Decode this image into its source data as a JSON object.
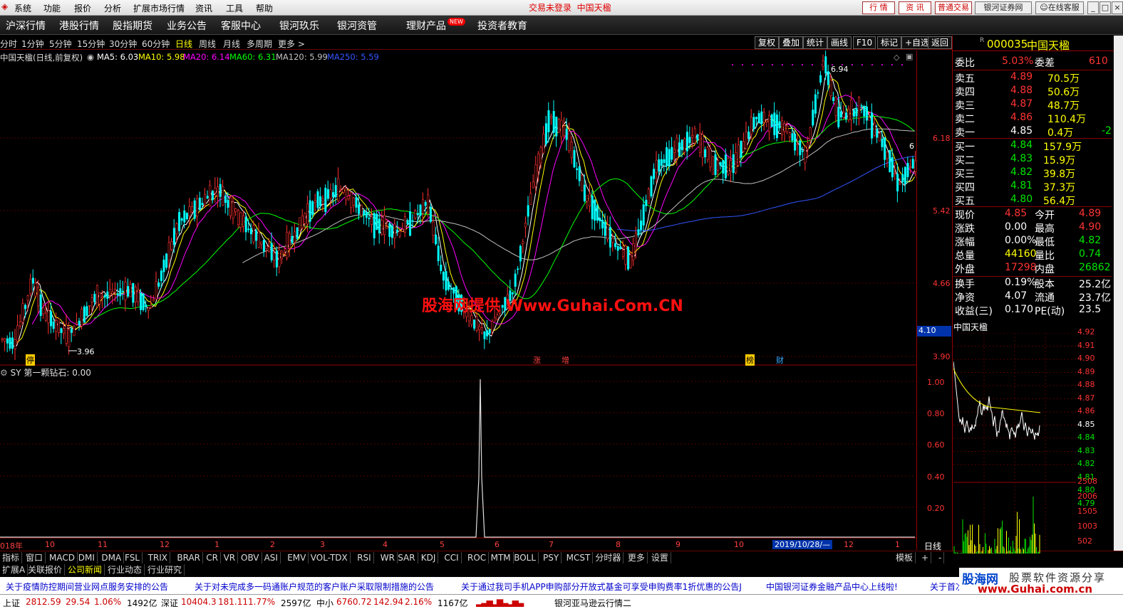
{
  "menu": {
    "items": [
      "系统",
      "功能",
      "报价",
      "分析",
      "扩展市场行情",
      "资讯",
      "工具",
      "帮助"
    ],
    "status_text": "交易未登录",
    "stock_title": "中国天楹",
    "buttons": [
      "行 情",
      "资 讯",
      "普通交易",
      "银河证券网",
      "在线客服"
    ]
  },
  "nav": {
    "items": [
      "沪深行情",
      "港股行情",
      "股指期货",
      "业务公告",
      "客服中心",
      "银河玖乐",
      "银河资管",
      "理财产品",
      "投资者教育"
    ],
    "badge": "NEW"
  },
  "periods": {
    "items": [
      "分时",
      "1分钟",
      "5分钟",
      "15分钟",
      "30分钟",
      "60分钟",
      "日线",
      "周线",
      "月线",
      "多周期",
      "更多 >"
    ],
    "active": "日线"
  },
  "tools": [
    "复权",
    "叠加",
    "统计",
    "画线",
    "F10",
    "标记",
    "+自选",
    "返回"
  ],
  "legend": {
    "name": "中国天楹(日线,前复权)",
    "ma5": "MA5: 6.03",
    "ma10": "MA10: 5.98",
    "ma20": "MA20: 6.14",
    "ma60": "MA60: 6.31",
    "ma120": "MA120: 5.99",
    "ma250": "MA250: 5.59"
  },
  "colors": {
    "ma5": "#ffffff",
    "ma10": "#ffff00",
    "ma20": "#ff00ff",
    "ma60": "#00ff00",
    "ma120": "#c0c0c0",
    "ma250": "#3355ff",
    "up": "#ff3030",
    "down": "#00ffff"
  },
  "main_axis": {
    "labels": [
      "6.18",
      "5.42",
      "4.66",
      "3.90"
    ],
    "current": "4.10"
  },
  "annotations": {
    "high": "6.94",
    "low": "3.96",
    "right": "6",
    "markers": [
      "停",
      "涨",
      "增",
      "榜",
      "财"
    ]
  },
  "watermark": "股海网提供 Www.Guhai.Com.CN",
  "indicator": {
    "title": "SY 第一颗钻石: 0.00",
    "axis": [
      "1.00",
      "0.80",
      "0.60",
      "0.40",
      "0.20"
    ]
  },
  "time_axis": {
    "labels": [
      "018年",
      "10",
      "11",
      "12",
      "1",
      "2",
      "3",
      "4",
      "5",
      "6",
      "7",
      "8",
      "9",
      "10",
      "12",
      "1"
    ],
    "cursor": "2019/10/28/—",
    "mode": "日线"
  },
  "indicator_tabs": [
    "指标",
    "窗口",
    "MACD",
    "DMI",
    "DMA",
    "FSL",
    "TRIX",
    "BRAR",
    "CR",
    "VR",
    "OBV",
    "ASI",
    "EMV",
    "VOL-TDX",
    "RSI",
    "WR",
    "SAR",
    "KDJ",
    "CCI",
    "ROC",
    "MTM",
    "BOLL",
    "PSY",
    "MCST",
    "分时器",
    "更多",
    "设置"
  ],
  "template_btn": "模板",
  "tabs2": [
    "扩展A",
    "关联报价",
    "公司新闻",
    "行业动态",
    "行业研究"
  ],
  "news": [
    "关于疫情防控期间营业网点服务安排的公告",
    "关于对未完成多一码通账户规范的客户账户采取限制措施的公告",
    "关于通过我司手机APP申购部分开放式基金可享受申购费率1折优惠的公告J",
    "中国银河证券金融产品中心上线啦!",
    "关于首次"
  ],
  "status": {
    "sh": "上证",
    "sh_val": "2812.59",
    "sh_chg": "29.54",
    "sh_pct": "1.06%",
    "sh_amt": "1492亿",
    "sz": "深证",
    "sz_val": "10404.3",
    "sz_chg": "181.11",
    "sz_pct": "1.77%",
    "sz_amt": "2597亿",
    "zx": "中小",
    "zx_val": "6760.72",
    "zx_chg": "142.94",
    "zx_pct": "2.16%",
    "zx_amt": "1167亿",
    "broker": "银河亚马逊云行情二"
  },
  "quote": {
    "code": "000035",
    "name": "中国天楹",
    "prefix": "R",
    "wb_label": "委比",
    "wb": "5.03%",
    "wc_label": "委差",
    "wc": "610",
    "sells": [
      [
        "卖五",
        "4.89",
        "70.5万"
      ],
      [
        "卖四",
        "4.88",
        "50.6万"
      ],
      [
        "卖三",
        "4.87",
        "48.7万"
      ],
      [
        "卖二",
        "4.86",
        "110.4万"
      ],
      [
        "卖一",
        "4.85",
        "0.4万"
      ]
    ],
    "sell1_extra": "-2",
    "buys": [
      [
        "买一",
        "4.84",
        "157.9万"
      ],
      [
        "买二",
        "4.83",
        "15.9万"
      ],
      [
        "买三",
        "4.82",
        "39.8万"
      ],
      [
        "买四",
        "4.81",
        "37.3万"
      ],
      [
        "买五",
        "4.80",
        "56.4万"
      ]
    ],
    "stats": [
      [
        "现价",
        "4.85",
        "今开",
        "4.89"
      ],
      [
        "涨跌",
        "0.00",
        "最高",
        "4.90"
      ],
      [
        "涨幅",
        "0.00%",
        "最低",
        "4.82"
      ],
      [
        "总量",
        "44160",
        "量比",
        "0.74"
      ],
      [
        "外盘",
        "17298",
        "内盘",
        "26862"
      ],
      [
        "换手",
        "0.19%",
        "股本",
        "25.2亿"
      ],
      [
        "净资",
        "4.07",
        "流通",
        "23.7亿"
      ],
      [
        "收益(三)",
        "0.170",
        "PE(动)",
        "23.5"
      ]
    ]
  },
  "mini": {
    "title": "中国天楹",
    "price_axis": [
      "4.92",
      "4.91",
      "4.90",
      "4.89",
      "4.88",
      "4.87",
      "4.86",
      "4.85",
      "4.84",
      "4.83",
      "4.82",
      "4.81",
      "4.80",
      "4.79"
    ],
    "vol_axis": [
      "2508",
      "2006",
      "1505",
      "1003",
      "502"
    ]
  },
  "logo": {
    "brand": "股海网",
    "slogan": "股票软件资源分享",
    "url": "www.Guhai.com.cn"
  }
}
